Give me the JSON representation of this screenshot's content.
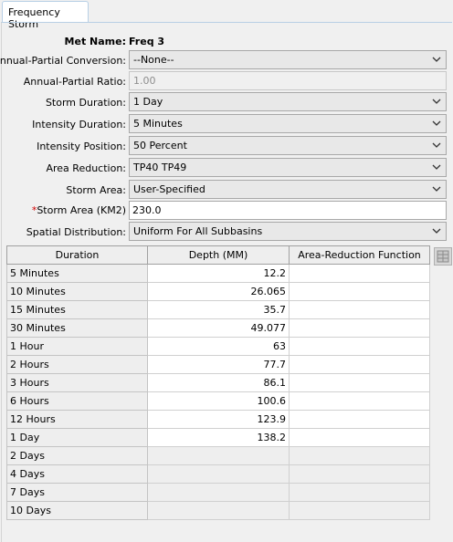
{
  "tab": {
    "label": "Frequency Storm"
  },
  "form": {
    "met_name_label": "Met Name:",
    "met_name_value": "Freq 3",
    "annual_partial_conversion_label": "Annual-Partial Conversion:",
    "annual_partial_conversion_value": "--None--",
    "annual_partial_ratio_label": "Annual-Partial Ratio:",
    "annual_partial_ratio_value": "1.00",
    "storm_duration_label": "Storm Duration:",
    "storm_duration_value": "1 Day",
    "intensity_duration_label": "Intensity Duration:",
    "intensity_duration_value": "5 Minutes",
    "intensity_position_label": "Intensity Position:",
    "intensity_position_value": "50 Percent",
    "area_reduction_label": "Area Reduction:",
    "area_reduction_value": "TP40 TP49",
    "storm_area_label": "Storm Area:",
    "storm_area_value": "User-Specified",
    "storm_area_km2_required": "*",
    "storm_area_km2_label": "Storm Area (KM2)",
    "storm_area_km2_value": "230.0",
    "spatial_distribution_label": "Spatial Distribution:",
    "spatial_distribution_value": "Uniform For All Subbasins"
  },
  "table": {
    "headers": [
      "Duration",
      "Depth (MM)",
      "Area-Reduction Function"
    ],
    "rows": [
      {
        "duration": "5 Minutes",
        "depth": "12.2",
        "arf": ""
      },
      {
        "duration": "10 Minutes",
        "depth": "26.065",
        "arf": ""
      },
      {
        "duration": "15 Minutes",
        "depth": "35.7",
        "arf": ""
      },
      {
        "duration": "30 Minutes",
        "depth": "49.077",
        "arf": ""
      },
      {
        "duration": "1 Hour",
        "depth": "63",
        "arf": ""
      },
      {
        "duration": "2 Hours",
        "depth": "77.7",
        "arf": ""
      },
      {
        "duration": "3 Hours",
        "depth": "86.1",
        "arf": ""
      },
      {
        "duration": "6 Hours",
        "depth": "100.6",
        "arf": ""
      },
      {
        "duration": "12 Hours",
        "depth": "123.9",
        "arf": ""
      },
      {
        "duration": "1 Day",
        "depth": "138.2",
        "arf": ""
      },
      {
        "duration": "2 Days",
        "depth": "",
        "arf": ""
      },
      {
        "duration": "4 Days",
        "depth": "",
        "arf": ""
      },
      {
        "duration": "7 Days",
        "depth": "",
        "arf": ""
      },
      {
        "duration": "10 Days",
        "depth": "",
        "arf": ""
      }
    ]
  },
  "icons": {
    "dropdown": "chevron-down-icon",
    "table_button": "table-icon"
  }
}
